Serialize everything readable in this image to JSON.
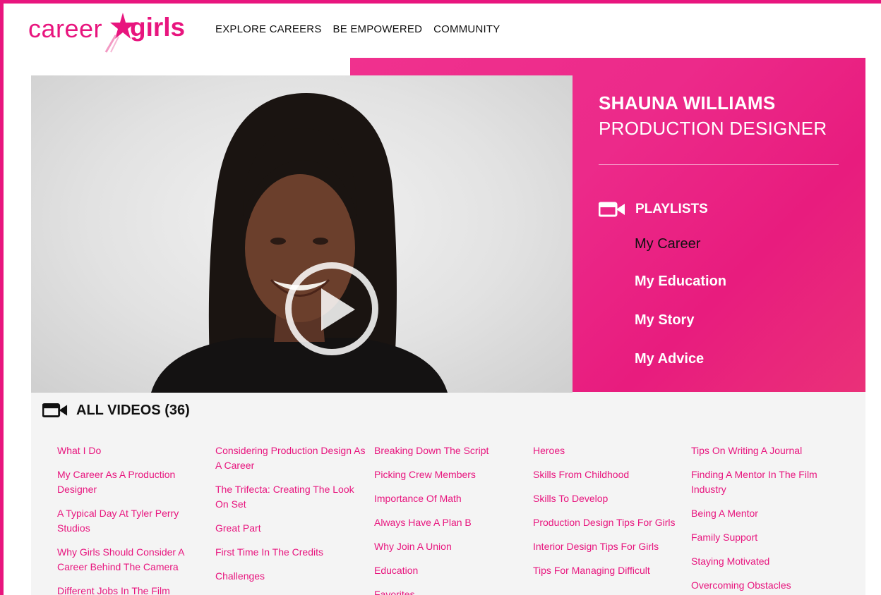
{
  "brand": {
    "logo_part1": "career",
    "logo_part2": "girls",
    "accent": "#e8157e",
    "panel_color": "#ec2a8a"
  },
  "nav": {
    "items": [
      "EXPLORE CAREERS",
      "BE EMPOWERED",
      "COMMUNITY"
    ]
  },
  "video": {
    "play_icon": "play-icon"
  },
  "profile": {
    "name": "SHAUNA WILLIAMS",
    "title": "PRODUCTION DESIGNER"
  },
  "playlists": {
    "heading": "PLAYLISTS",
    "icon": "video-camera-icon",
    "items": [
      "My Career",
      "My Education",
      "My Story",
      "My Advice"
    ],
    "active": "My Career"
  },
  "all_videos": {
    "heading": "ALL VIDEOS (36)",
    "icon": "video-camera-icon",
    "columns": [
      [
        "What I Do",
        "My Career As A Production Designer",
        "A Typical Day At Tyler Perry Studios",
        "Why Girls Should Consider A Career Behind The Camera",
        "Different Jobs In The Film"
      ],
      [
        "Considering Production Design As A Career",
        "The Trifecta: Creating The Look On Set",
        "Great Part",
        "First Time In The Credits",
        "Challenges"
      ],
      [
        "Breaking Down The Script",
        "Picking Crew Members",
        "Importance Of Math",
        "Always Have A Plan B",
        "Why Join A Union",
        "Education",
        "Favorites"
      ],
      [
        "Heroes",
        "Skills From Childhood",
        "Skills To Develop",
        "Production Design Tips For Girls",
        "Interior Design Tips For Girls",
        "Tips For Managing Difficult"
      ],
      [
        "Tips On Writing A Journal",
        "Finding A Mentor In The Film Industry",
        "Being A Mentor",
        "Family Support",
        "Staying Motivated",
        "Overcoming Obstacles"
      ]
    ]
  }
}
